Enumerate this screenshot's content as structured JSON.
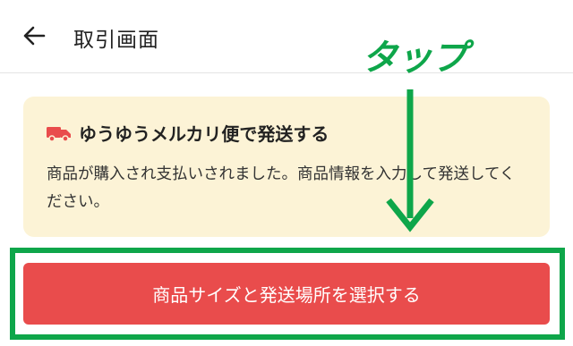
{
  "header": {
    "back_icon": "arrow-left-icon",
    "title": "取引画面"
  },
  "annotation": {
    "tap_label": "タップ",
    "color": "#0ea64a"
  },
  "notice": {
    "icon": "truck-icon",
    "title": "ゆうゆうメルカリ便で発送する",
    "body": "商品が購入され支払いされました。商品情報を入力して発送してください。",
    "background": "#fcf3d6"
  },
  "cta": {
    "label": "商品サイズと発送場所を選択する",
    "color": "#e94c4c"
  }
}
